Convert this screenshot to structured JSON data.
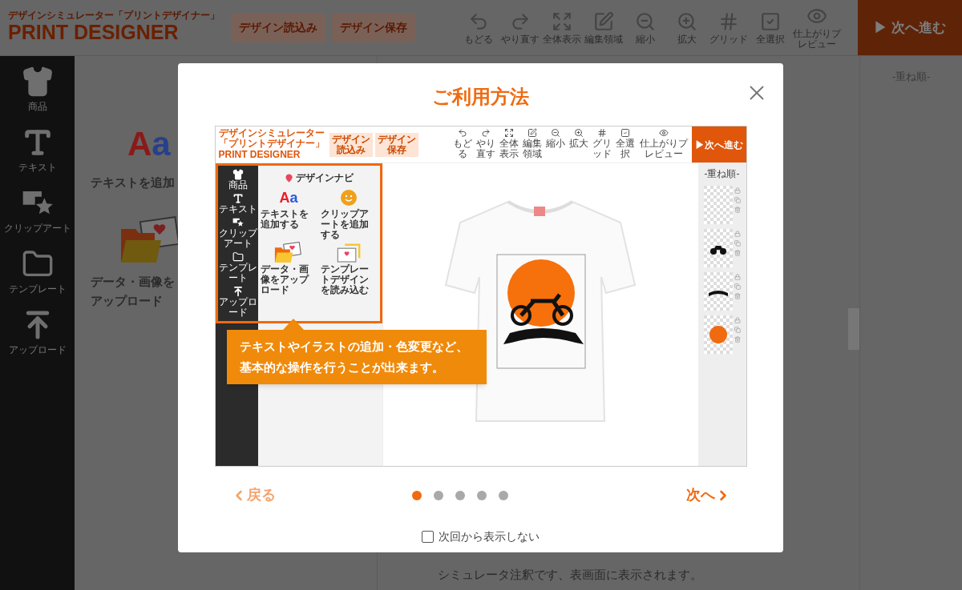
{
  "header": {
    "logo_subtitle": "デザインシミュレーター「プリントデザイナー」",
    "logo_title": "PRINT DESIGNER",
    "buttons": [
      "デザイン読込み",
      "デザイン保存"
    ],
    "toolbar": [
      {
        "kind": "undo",
        "label": "もどる"
      },
      {
        "kind": "redo",
        "label": "やり直す"
      },
      {
        "kind": "fit",
        "label": "全体表示"
      },
      {
        "kind": "edit",
        "label": "編集領域"
      },
      {
        "kind": "zoomout",
        "label": "縮小"
      },
      {
        "kind": "zoomin",
        "label": "拡大"
      },
      {
        "kind": "grid",
        "label": "グリッド"
      },
      {
        "kind": "selectall",
        "label": "全選択"
      },
      {
        "kind": "preview",
        "label": "仕上がりプレビュー"
      }
    ],
    "next_button": "▶ 次へ進む"
  },
  "sidebar": {
    "items": [
      {
        "kind": "product",
        "label": "商品"
      },
      {
        "kind": "text",
        "label": "テキスト"
      },
      {
        "kind": "clipart",
        "label": "クリップアート"
      },
      {
        "kind": "template",
        "label": "テンプレート"
      },
      {
        "kind": "upload",
        "label": "アップロード"
      }
    ]
  },
  "nav_panel": {
    "sample": "Aa",
    "items": [
      {
        "kind": "text",
        "label": "テキストを追加"
      },
      {
        "kind": "upload",
        "label": "データ・画像をアップロード"
      }
    ]
  },
  "layers_panel": {
    "title": "-重ね順-"
  },
  "canvas": {
    "note": "シミュレータ注釈です、表画面に表示されます。"
  },
  "modal": {
    "title": "ご利用方法",
    "screenshot": {
      "header": {
        "logo_subtitle": "デザインシミュレーター「プリントデザイナー」",
        "logo_title": "PRINT DESIGNER",
        "buttons": [
          "デザイン読込み",
          "デザイン保存"
        ],
        "toolbar": [
          {
            "kind": "undo",
            "label": "もどる"
          },
          {
            "kind": "redo",
            "label": "やり直す"
          },
          {
            "kind": "fit",
            "label": "全体表示"
          },
          {
            "kind": "edit",
            "label": "編集領域"
          },
          {
            "kind": "zoomout",
            "label": "縮小"
          },
          {
            "kind": "zoomin",
            "label": "拡大"
          },
          {
            "kind": "grid",
            "label": "グリッド"
          },
          {
            "kind": "selectall",
            "label": "全選択"
          },
          {
            "kind": "preview",
            "label": "仕上がりプレビュー"
          }
        ],
        "next_button": "▶次へ進む"
      },
      "sidebar": {
        "items": [
          {
            "kind": "product",
            "label": "商品"
          },
          {
            "kind": "text",
            "label": "テキスト"
          },
          {
            "kind": "clipart",
            "label": "クリップアート"
          },
          {
            "kind": "template",
            "label": "テンプレート"
          },
          {
            "kind": "upload",
            "label": "アップロード"
          }
        ]
      },
      "nav": {
        "title": "デザインナビ",
        "sample": "Aa",
        "items": [
          {
            "kind": "text",
            "label": "テキストを追加する"
          },
          {
            "kind": "clipart",
            "label": "クリップアートを追加する"
          },
          {
            "kind": "upload",
            "label": "データ・画像をアップロード"
          },
          {
            "kind": "template",
            "label": "テンプレートデザインを読み込む"
          }
        ]
      },
      "layers": {
        "title": "-重ね順-",
        "items": [
          {
            "kind": "empty"
          },
          {
            "kind": "motorcycle"
          },
          {
            "kind": "banner"
          },
          {
            "kind": "circle"
          }
        ]
      },
      "callout": "テキストやイラストの追加・色変更など、基本的な操作を行うことが出来ます。"
    },
    "back": {
      "label": "戻る",
      "disabled": true
    },
    "pages": [
      {
        "selected": true
      },
      {
        "selected": false
      },
      {
        "selected": false
      },
      {
        "selected": false
      },
      {
        "selected": false
      }
    ],
    "next": {
      "label": "次へ",
      "disabled": false
    },
    "checkbox": {
      "label": "次回から表示しない",
      "checked": false
    }
  }
}
